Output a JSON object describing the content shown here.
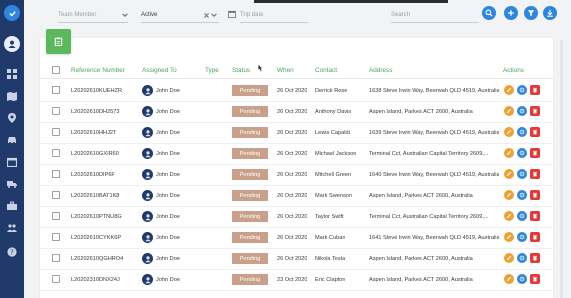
{
  "colors": {
    "sidebar": "#1f3a6b",
    "accent": "#2e86de",
    "header_text": "#4da35a",
    "pending": "#c9a08a",
    "edit": "#f0a030",
    "delete": "#e53935",
    "add": "#5cb85c"
  },
  "filters": {
    "team_member_placeholder": "Team Member",
    "status_value": "Active",
    "trip_date_placeholder": "Trip date",
    "search_placeholder": "Search"
  },
  "sidebar": {
    "icons": [
      "check-logo",
      "user-avatar",
      "dashboard-icon",
      "map-icon",
      "location-icon",
      "car-icon",
      "calendar-icon",
      "truck-icon",
      "briefcase-icon",
      "people-icon",
      "help-icon"
    ]
  },
  "table": {
    "headers": {
      "reference": "Reference Number",
      "assigned": "Assigned To",
      "type": "Type",
      "status": "Status",
      "when": "When",
      "contact": "Contact",
      "address": "Address",
      "actions": "Actions"
    },
    "rows": [
      {
        "ref": "L20202610KUEHZR",
        "assigned": "John Doe",
        "type": "",
        "status": "Pending",
        "when": "26 Oct 2020",
        "contact": "Derrick Rose",
        "address": "1638 Steve Irwin Way, Beerwah QLD 4519, Australia"
      },
      {
        "ref": "L20202610DH2573",
        "assigned": "John Doe",
        "type": "",
        "status": "Pending",
        "when": "26 Oct 2020",
        "contact": "Anthony Davis",
        "address": "Aspen Island, Parkes ACT 2600, Australia"
      },
      {
        "ref": "L20202610HHJ2T",
        "assigned": "John Doe",
        "type": "",
        "status": "Pending",
        "when": "26 Oct 2020",
        "contact": "Lewis Capaldi",
        "address": "1639 Steve Irwin Way, Beerwah QLD 4519, Australia"
      },
      {
        "ref": "L20202610GXIR60",
        "assigned": "John Doe",
        "type": "",
        "status": "Pending",
        "when": "26 Oct 2020",
        "contact": "Michael Jackson",
        "address": "Terminal Cct, Australian Capital Territory 2609,..."
      },
      {
        "ref": "L20202610DIP6F",
        "assigned": "John Doe",
        "type": "",
        "status": "Pending",
        "when": "26 Oct 2020",
        "contact": "Mitchell Green",
        "address": "1640 Steve Irwin Way, Beerwah QLD 4519, Australia"
      },
      {
        "ref": "L20202610BAT1K8",
        "assigned": "John Doe",
        "type": "",
        "status": "Pending",
        "when": "26 Oct 2020",
        "contact": "Mark Swenson",
        "address": "Aspen Island, Parkes ACT 2600, Australia"
      },
      {
        "ref": "L20202610PTNU8G",
        "assigned": "John Doe",
        "type": "",
        "status": "Pending",
        "when": "26 Oct 2020",
        "contact": "Taylor Swift",
        "address": "Terminal Cct, Australian Capital Territory 2609,..."
      },
      {
        "ref": "L20202610CYKK6P",
        "assigned": "John Doe",
        "type": "",
        "status": "Pending",
        "when": "26 Oct 2020",
        "contact": "Mark Cuban",
        "address": "1641 Steve Irwin Way, Beerwah QLD 4519, Australia"
      },
      {
        "ref": "L20202610QGHRO4",
        "assigned": "John Doe",
        "type": "",
        "status": "Pending",
        "when": "26 Oct 2020",
        "contact": "Nikola Tesla",
        "address": "Aspen Island, Parkes ACT 2600, Australia"
      },
      {
        "ref": "L20202310DNX24J",
        "assigned": "John Doe",
        "type": "",
        "status": "Pending",
        "when": "23 Oct 2020",
        "contact": "Eric Clapton",
        "address": "Aspen Island, Parkes ACT 2600, Australia"
      }
    ]
  }
}
